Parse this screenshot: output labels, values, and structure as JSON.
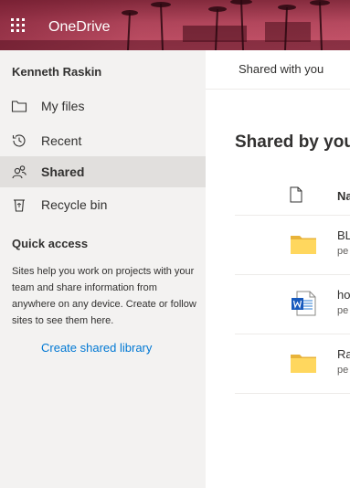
{
  "app": {
    "name": "OneDrive"
  },
  "icons": {
    "app_launcher": "waffle-icon"
  },
  "user": {
    "name": "Kenneth Raskin"
  },
  "nav": {
    "items": [
      {
        "label": "My files",
        "icon": "folder-icon",
        "selected": false
      },
      {
        "label": "Recent",
        "icon": "clock-icon",
        "selected": false
      },
      {
        "label": "Shared",
        "icon": "people-icon",
        "selected": true
      },
      {
        "label": "Recycle bin",
        "icon": "recycle-bin-icon",
        "selected": false
      }
    ]
  },
  "quick_access": {
    "title": "Quick access",
    "description": "Sites help you work on projects with your team and share information from anywhere on any device. Create or follow sites to see them here.",
    "link": "Create shared library"
  },
  "main": {
    "tab": "Shared with you",
    "title": "Shared by you",
    "column_name": "Na",
    "rows": [
      {
        "name": "BL",
        "sub": "pe",
        "type": "folder"
      },
      {
        "name": "ho",
        "sub": "pe",
        "type": "word"
      },
      {
        "name": "Ra",
        "sub": "pe",
        "type": "folder"
      }
    ]
  },
  "colors": {
    "accent": "#0078d4",
    "nav_bg": "#f3f2f1",
    "selected_bg": "#e1dfdd",
    "folder": "#ffd75e"
  }
}
